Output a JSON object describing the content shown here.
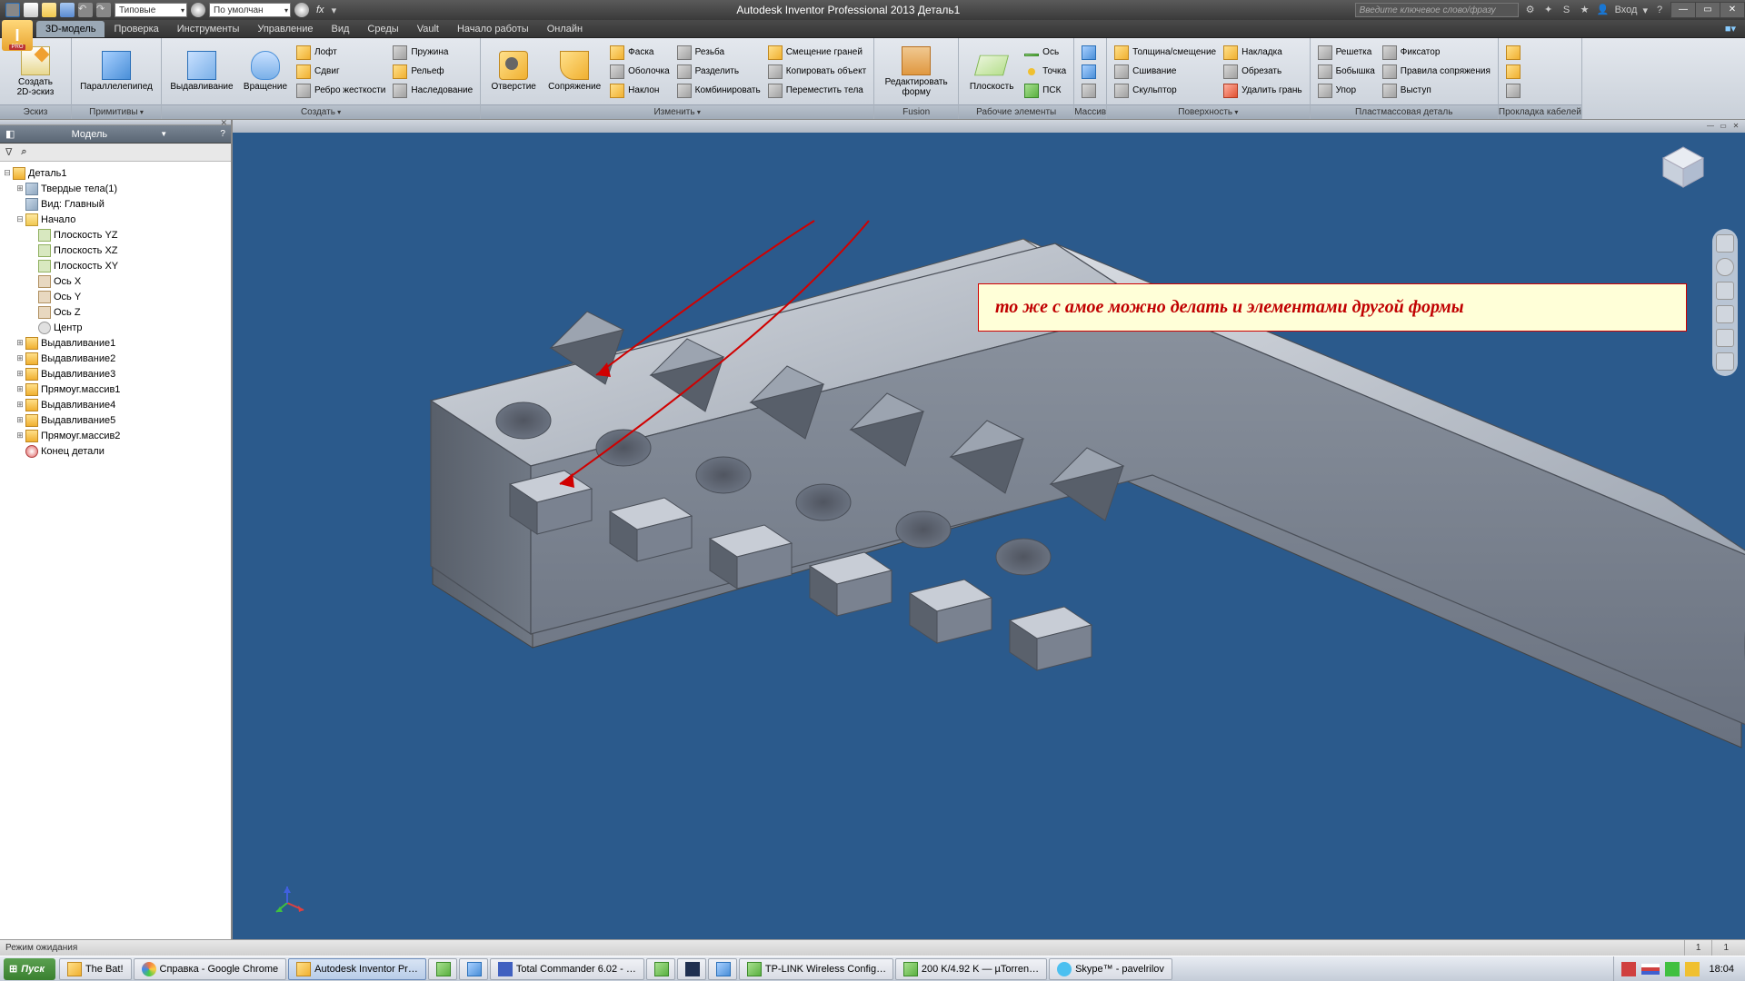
{
  "titlebar": {
    "combo1": "Типовые",
    "combo2": "По умолчан",
    "fx": "fx",
    "title": "Autodesk Inventor Professional 2013   Деталь1",
    "search_placeholder": "Введите ключевое слово/фразу",
    "login": "Вход"
  },
  "tabs": [
    "3D-модель",
    "Проверка",
    "Инструменты",
    "Управление",
    "Вид",
    "Среды",
    "Vault",
    "Начало работы",
    "Онлайн"
  ],
  "active_tab": 0,
  "ribbon": {
    "sketch": {
      "title": "Эскиз",
      "create_sketch": "Создать\n2D-эскиз"
    },
    "primitives": {
      "title": "Примитивы",
      "box": "Параллелепипед"
    },
    "create": {
      "title": "Создать",
      "extrude": "Выдавливание",
      "revolve": "Вращение",
      "loft": "Лофт",
      "sweep": "Сдвиг",
      "rib": "Ребро жесткости",
      "coil": "Пружина",
      "emboss": "Рельеф",
      "derive": "Наследование"
    },
    "modify": {
      "title": "Изменить",
      "hole": "Отверстие",
      "fillet": "Сопряжение",
      "chamfer": "Фаска",
      "shell": "Оболочка",
      "draft": "Наклон",
      "thread": "Резьба",
      "split": "Разделить",
      "combine": "Комбинировать",
      "move_face": "Смещение граней",
      "copy_obj": "Копировать объект",
      "move_body": "Переместить тела"
    },
    "fusion": {
      "title": "Fusion",
      "edit_form": "Редактировать\nформу"
    },
    "work": {
      "title": "Рабочие элементы",
      "plane": "Плоскость",
      "axis": "Ось",
      "point": "Точка",
      "ucs": "ПСК"
    },
    "pattern": {
      "title": "Массив"
    },
    "surface": {
      "title": "Поверхность",
      "thicken": "Толщина/смещение",
      "stitch": "Сшивание",
      "sculpt": "Скульптор",
      "patch": "Накладка",
      "trim": "Обрезать",
      "delete_face": "Удалить грань"
    },
    "plastic": {
      "title": "Пластмассовая деталь",
      "grill": "Решетка",
      "boss": "Бобышка",
      "rest": "Упор",
      "snap": "Фиксатор",
      "rule": "Правила сопряжения",
      "lip": "Выступ"
    },
    "harness": {
      "title": "Прокладка кабелей"
    }
  },
  "browser": {
    "title": "Модель",
    "root": "Деталь1",
    "solid_bodies": "Твердые тела(1)",
    "view": "Вид: Главный",
    "origin": "Начало",
    "planes": [
      "Плоскость YZ",
      "Плоскость XZ",
      "Плоскость XY"
    ],
    "axes": [
      "Ось X",
      "Ось Y",
      "Ось Z"
    ],
    "center": "Центр",
    "features": [
      "Выдавливание1",
      "Выдавливание2",
      "Выдавливание3",
      "Прямоуг.массив1",
      "Выдавливание4",
      "Выдавливание5",
      "Прямоуг.массив2"
    ],
    "end": "Конец детали"
  },
  "callout": "то же с амое можно делать и элементами другой формы",
  "status": {
    "text": "Режим ожидания",
    "page": "1",
    "zoom": "1"
  },
  "taskbar": {
    "start": "Пуск",
    "items": [
      "The Bat!",
      "Справка - Google Chrome",
      "Autodesk Inventor Pr…",
      "",
      "",
      "Total Commander 6.02 - …",
      "",
      "",
      "",
      "TP-LINK Wireless Config…",
      "200 K/4.92 K — µTorren…",
      "Skype™ - pavelrilov"
    ],
    "clock": "18:04"
  }
}
